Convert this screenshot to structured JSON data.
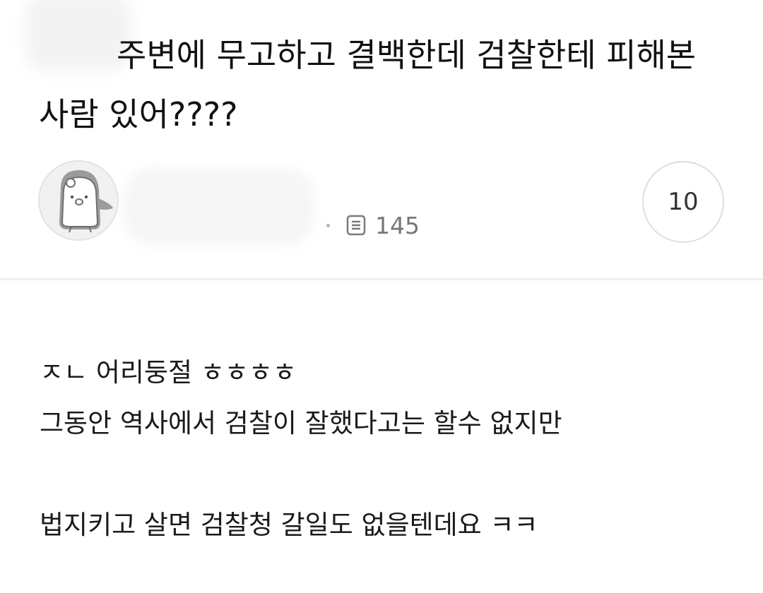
{
  "post": {
    "title": "주변에 무고하고 결백한데 검찰한테 피해본 사람 있어????",
    "view_count": "145",
    "comment_count": "10"
  },
  "icons": {
    "avatar": "penguin-avatar-icon",
    "views": "document-icon"
  },
  "content": {
    "line1": "ㅈㄴ 어리둥절 ㅎㅎㅎㅎ",
    "line2": "그동안 역사에서 검찰이 잘했다고는 할수 없지만",
    "line3": "법지키고 살면 검찰청 갈일도 없을텐데요 ㅋㅋ"
  },
  "colors": {
    "text": "#1e1e1e",
    "meta_text": "#777777",
    "divider": "#eeeeee",
    "border": "#dedede"
  }
}
